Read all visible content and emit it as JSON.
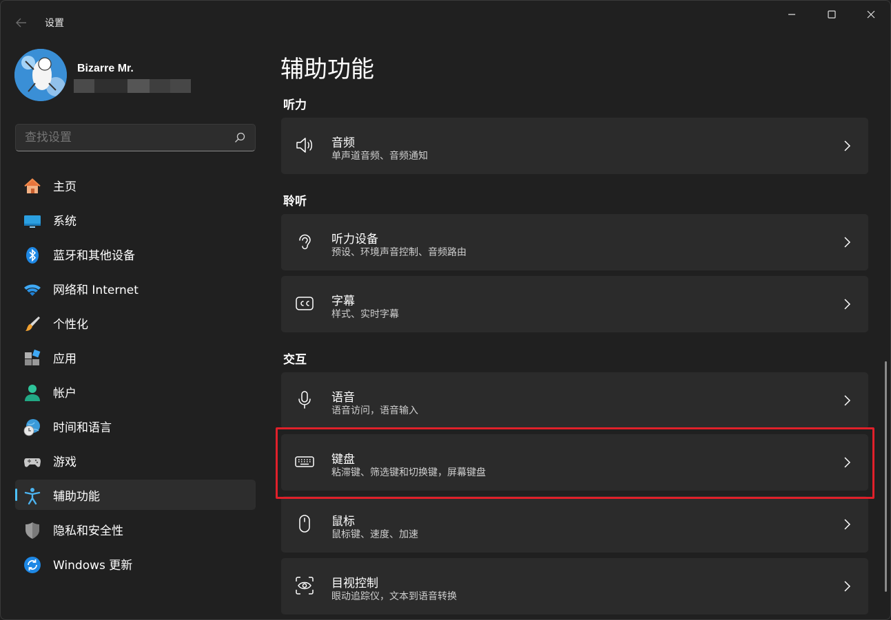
{
  "window": {
    "app_title": "设置"
  },
  "profile": {
    "name": "Bizarre Mr."
  },
  "search": {
    "placeholder": "查找设置"
  },
  "sidebar": {
    "items": [
      {
        "label": "主页",
        "icon": "home-icon"
      },
      {
        "label": "系统",
        "icon": "system-icon"
      },
      {
        "label": "蓝牙和其他设备",
        "icon": "bluetooth-icon"
      },
      {
        "label": "网络和 Internet",
        "icon": "wifi-icon"
      },
      {
        "label": "个性化",
        "icon": "brush-icon"
      },
      {
        "label": "应用",
        "icon": "apps-icon"
      },
      {
        "label": "帐户",
        "icon": "account-icon"
      },
      {
        "label": "时间和语言",
        "icon": "time-language-icon"
      },
      {
        "label": "游戏",
        "icon": "gaming-icon"
      },
      {
        "label": "辅助功能",
        "icon": "accessibility-icon",
        "active": true
      },
      {
        "label": "隐私和安全性",
        "icon": "shield-icon"
      },
      {
        "label": "Windows 更新",
        "icon": "update-icon"
      }
    ]
  },
  "main": {
    "title": "辅助功能",
    "sections": [
      {
        "title": "听力",
        "cards": [
          {
            "title": "音频",
            "subtitle": "单声道音频、音频通知",
            "icon": "speaker-icon"
          }
        ]
      },
      {
        "title": "聆听",
        "cards": [
          {
            "title": "听力设备",
            "subtitle": "预设、环境声音控制、音频路由",
            "icon": "ear-icon"
          },
          {
            "title": "字幕",
            "subtitle": "样式、实时字幕",
            "icon": "captions-icon"
          }
        ]
      },
      {
        "title": "交互",
        "cards": [
          {
            "title": "语音",
            "subtitle": "语音访问，语音输入",
            "icon": "microphone-icon"
          },
          {
            "title": "键盘",
            "subtitle": "粘滞键、筛选键和切换键，屏幕键盘",
            "icon": "keyboard-icon",
            "highlighted": true
          },
          {
            "title": "鼠标",
            "subtitle": "鼠标键、速度、加速",
            "icon": "mouse-icon"
          },
          {
            "title": "目视控制",
            "subtitle": "眼动追踪仪，文本到语音转换",
            "icon": "eye-control-icon"
          }
        ]
      }
    ]
  },
  "colors": {
    "background": "#202020",
    "card": "#2b2b2b",
    "accent": "#4cc2ff",
    "highlight_border": "#e0202a"
  }
}
